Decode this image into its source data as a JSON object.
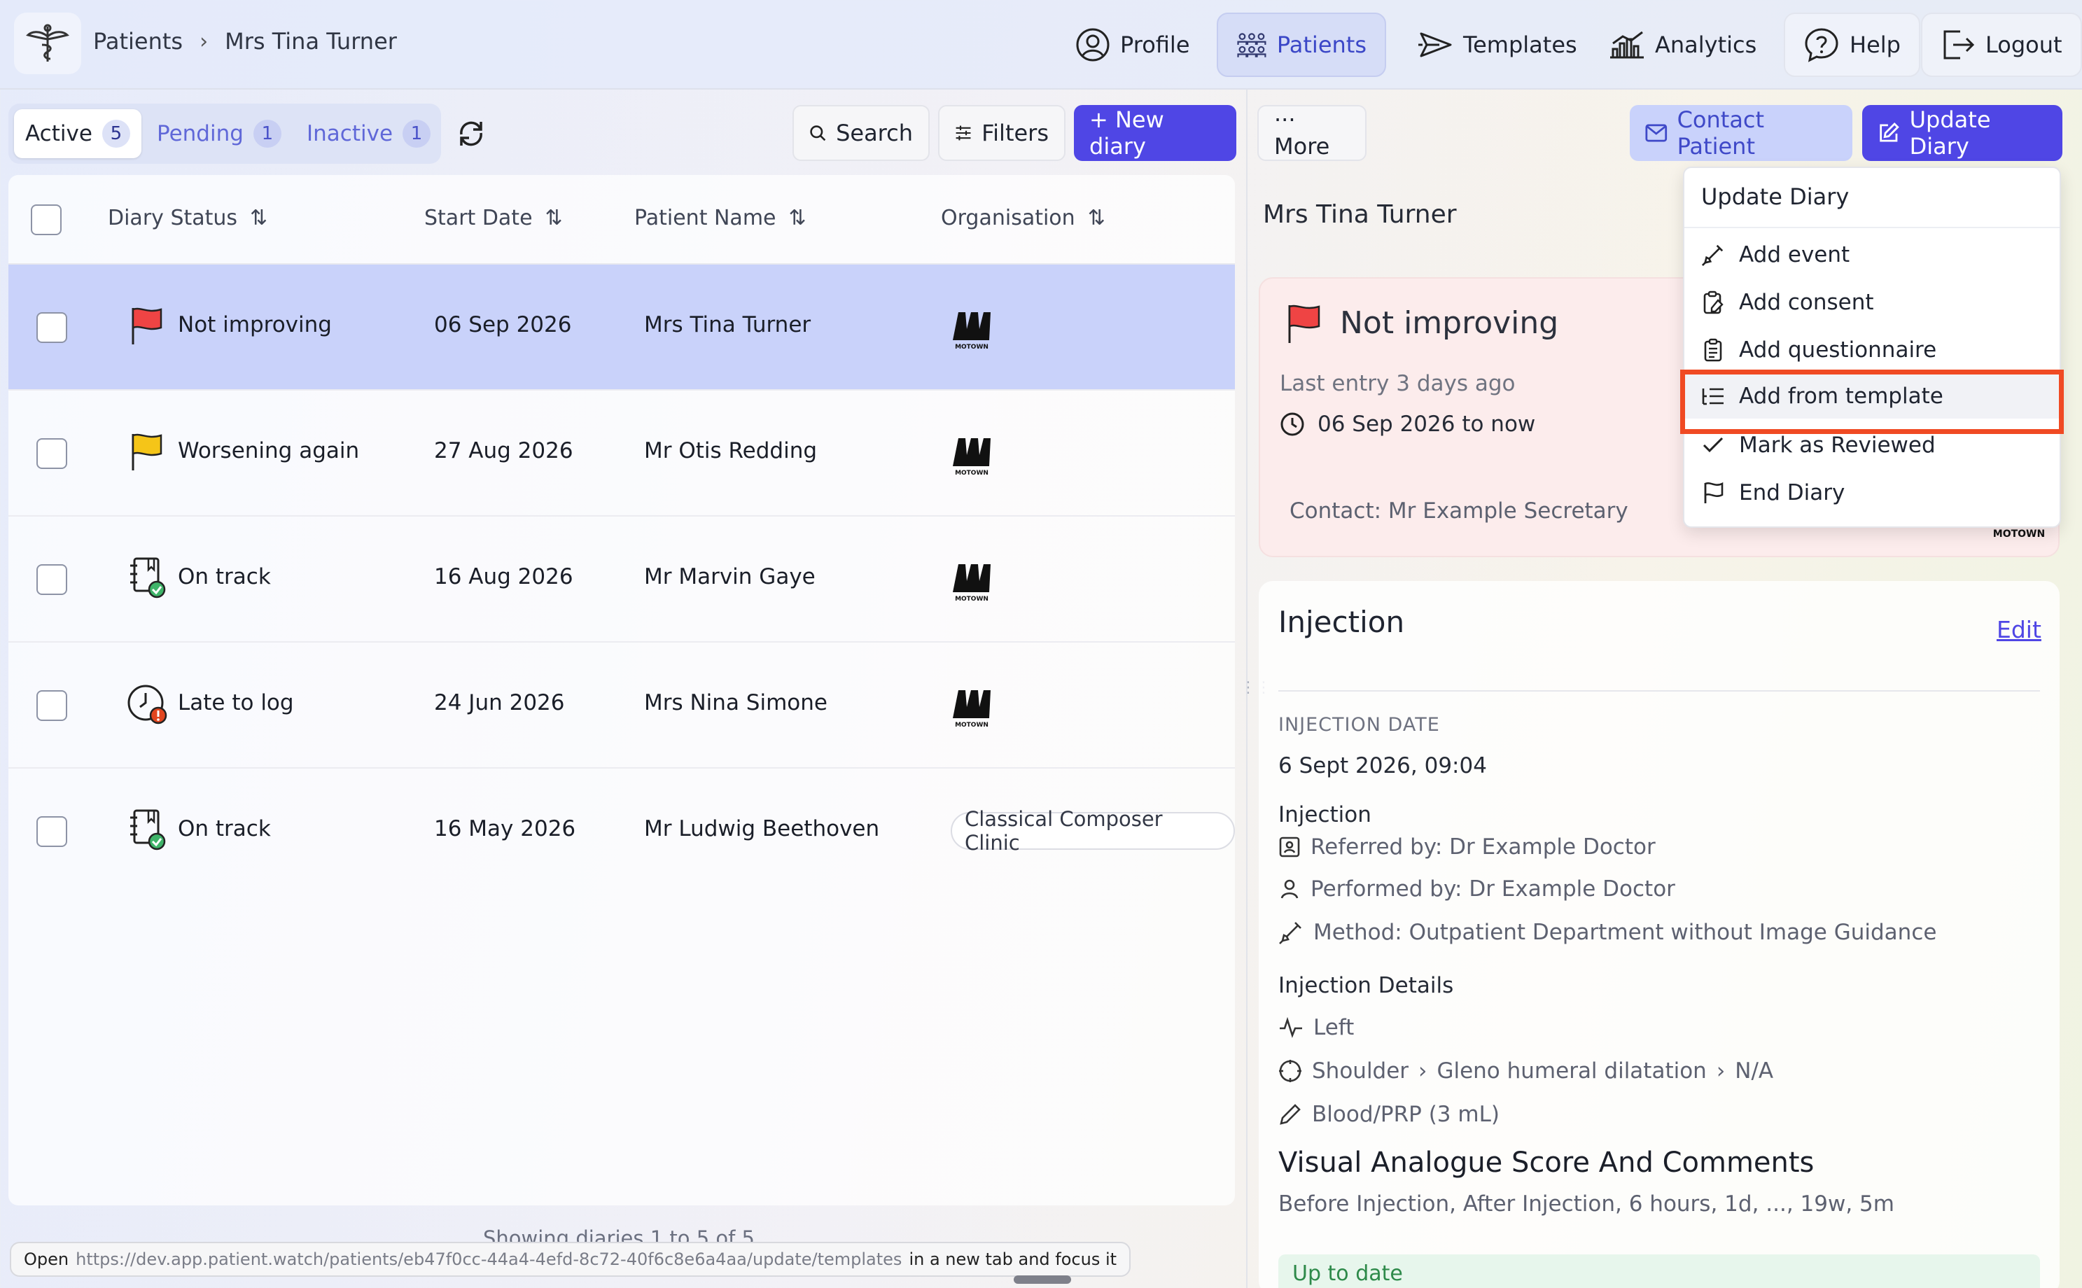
{
  "nav": {
    "breadcrumb": [
      "Patients",
      "Mrs Tina Turner"
    ],
    "items": [
      {
        "label": "Profile",
        "icon": "user-circle-icon"
      },
      {
        "label": "Patients",
        "icon": "users-group-icon",
        "active": true
      },
      {
        "label": "Templates",
        "icon": "send-icon"
      },
      {
        "label": "Analytics",
        "icon": "bar-chart-icon"
      },
      {
        "label": "Help",
        "icon": "help-icon"
      },
      {
        "label": "Logout",
        "icon": "logout-icon"
      }
    ]
  },
  "tabs": [
    {
      "label": "Active",
      "count": "5",
      "active": true
    },
    {
      "label": "Pending",
      "count": "1"
    },
    {
      "label": "Inactive",
      "count": "1"
    }
  ],
  "toolbar": {
    "search": "Search",
    "filters": "Filters",
    "new_diary": "+ New diary",
    "more": "··· More",
    "contact_patient": "Contact Patient",
    "update_diary": "Update Diary"
  },
  "table": {
    "columns": [
      "Diary Status",
      "Start Date",
      "Patient Name",
      "Organisation"
    ],
    "rows": [
      {
        "status": "Not improving",
        "status_icon": "red-flag-icon",
        "date": "06 Sep 2026",
        "name": "Mrs Tina Turner",
        "org": "MOTOWN",
        "selected": true
      },
      {
        "status": "Worsening again",
        "status_icon": "yellow-flag-icon",
        "date": "27 Aug 2026",
        "name": "Mr Otis Redding",
        "org": "MOTOWN"
      },
      {
        "status": "On track",
        "status_icon": "diary-check-icon",
        "date": "16 Aug 2026",
        "name": "Mr Marvin Gaye",
        "org": "MOTOWN"
      },
      {
        "status": "Late to log",
        "status_icon": "clock-alert-icon",
        "date": "24 Jun 2026",
        "name": "Mrs Nina Simone",
        "org": "MOTOWN"
      },
      {
        "status": "On track",
        "status_icon": "diary-check-icon",
        "date": "16 May 2026",
        "name": "Mr Ludwig Beethoven",
        "org": "Classical Composer Clinic"
      }
    ],
    "footer": "Showing diaries 1 to 5 of 5"
  },
  "detail": {
    "patient": "Mrs Tina Turner",
    "status": "Not improving",
    "last_entry": "Last entry 3 days ago",
    "dates": "06 Sep 2026 to now",
    "contact": "Contact: Mr Example Secretary",
    "org_logo": "MOTOWN",
    "section_title": "Injection",
    "edit": "Edit",
    "injection_date_label": "INJECTION DATE",
    "injection_date": "6 Sept 2026, 09:04",
    "injection_label": "Injection",
    "referred_by": "Referred by: Dr Example Doctor",
    "performed_by": "Performed by: Dr Example Doctor",
    "method": "Method: Outpatient Department without Image Guidance",
    "details_label": "Injection Details",
    "side": "Left",
    "site": [
      "Shoulder",
      "Gleno humeral dilatation",
      "N/A"
    ],
    "substance": "Blood/PRP (3 mL)",
    "vas_title": "Visual Analogue Score And Comments",
    "vas_sub": "Before Injection, After Injection, 6 hours, 1d, ..., 19w, 5m",
    "up_to_date": "Up to date"
  },
  "menu": {
    "title": "Update Diary",
    "items": [
      {
        "label": "Add event",
        "icon": "syringe-icon"
      },
      {
        "label": "Add consent",
        "icon": "clipboard-edit-icon"
      },
      {
        "label": "Add questionnaire",
        "icon": "clipboard-list-icon"
      },
      {
        "label": "Add from template",
        "icon": "list-template-icon",
        "highlighted": true
      },
      {
        "label": "Mark as Reviewed",
        "icon": "check-icon"
      },
      {
        "label": "End Diary",
        "icon": "flag-icon"
      }
    ]
  },
  "statusbar": {
    "prefix": "Open",
    "url": "https://dev.app.patient.watch/patients/eb47f0cc-44a4-4efd-8c72-40f6c8e6a4aa/update/templates",
    "suffix": "in a new tab and focus it"
  },
  "colors": {
    "accent": "#4f46e5",
    "selected_row": "#c9d2fa",
    "status_card": "#fcecec",
    "highlight_outline": "#f04a23",
    "red_flag": "#ef4444",
    "yellow_flag": "#f5c518"
  }
}
